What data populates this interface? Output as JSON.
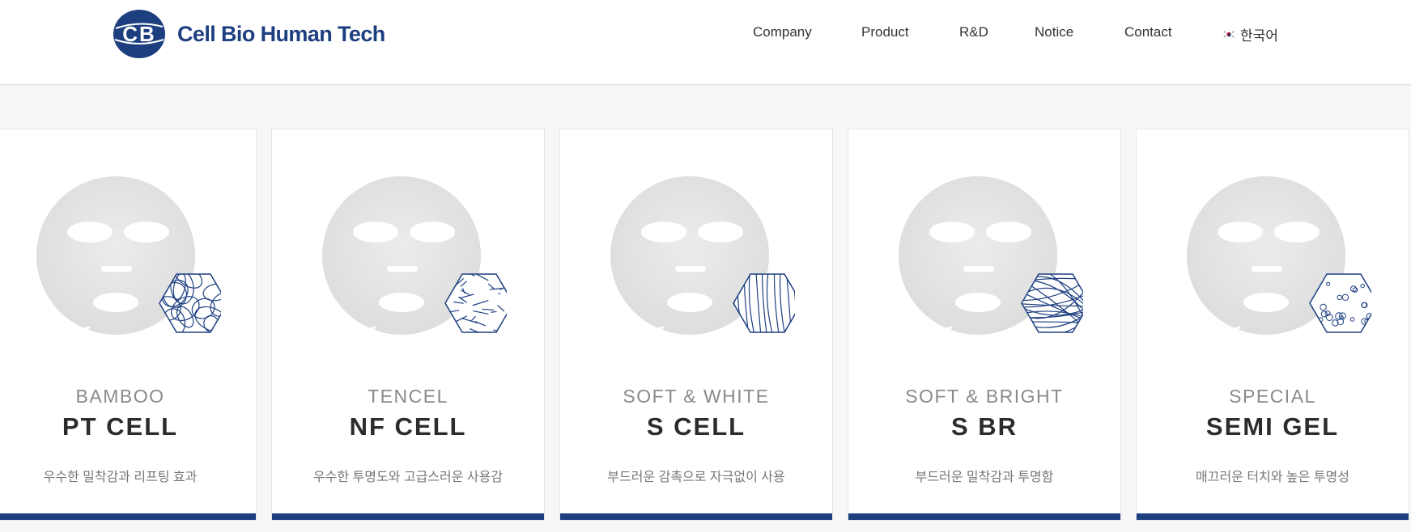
{
  "brand": {
    "name": "Cell Bio Human Tech",
    "logo_letters": "CB",
    "color": "#1d3f80"
  },
  "nav": [
    {
      "label": "Company"
    },
    {
      "label": "Product"
    },
    {
      "label": "R&D"
    },
    {
      "label": "Notice"
    },
    {
      "label": "Contact"
    }
  ],
  "language": {
    "label": "한국어",
    "icon": "korea-flag-icon"
  },
  "cards": [
    {
      "category": "BAMBOO",
      "name": "PT CELL",
      "description": "우수한 밀착감과 리프팅 효과",
      "texture": "loops"
    },
    {
      "category": "TENCEL",
      "name": "NF CELL",
      "description": "우수한 투명도와 고급스러운 사용감",
      "texture": "scribble"
    },
    {
      "category": "SOFT & WHITE",
      "name": "S CELL",
      "description": "부드러운 감촉으로 자극없이 사용",
      "texture": "strands"
    },
    {
      "category": "SOFT & BRIGHT",
      "name": "S BR",
      "description": "부드러운 밀착감과 투명함",
      "texture": "mesh"
    },
    {
      "category": "SPECIAL",
      "name": "SEMI GEL",
      "description": "매끄러운 터치와 높은 투명성",
      "texture": "dots"
    }
  ],
  "colors": {
    "accent": "#1d3f80",
    "card_bar": "#1d3f80",
    "mask": "#e7e7e7"
  }
}
